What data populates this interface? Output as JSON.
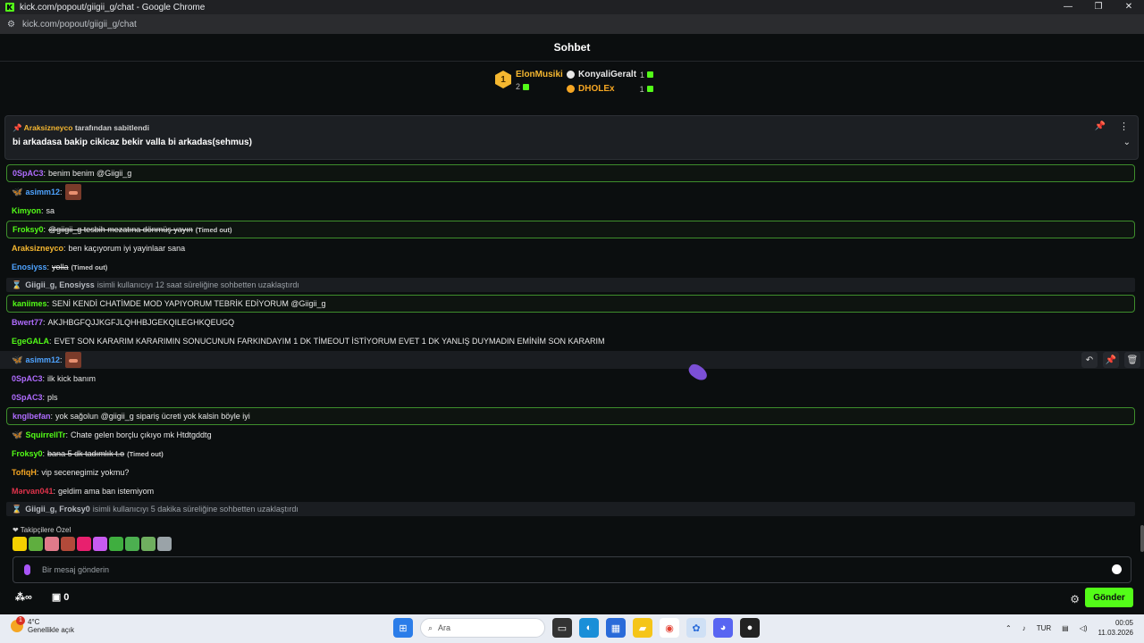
{
  "window": {
    "title": "kick.com/popout/giigii_g/chat - Google Chrome",
    "url": "kick.com/popout/giigii_g/chat",
    "controls": [
      "—",
      "❐",
      "✕"
    ]
  },
  "chat": {
    "title": "Sohbet"
  },
  "leaderboard": {
    "first": {
      "rank": "1",
      "name": "ElonMusiki",
      "count": "2"
    },
    "others": [
      {
        "name": "KonyaliGeralt",
        "count": "1",
        "color": "#e8e8e8"
      },
      {
        "name": "DHOLEx",
        "count": "1",
        "color": "#f5a623"
      }
    ]
  },
  "pinned": {
    "pinned_by_user": "Araksizneyco",
    "pinned_by_suffix": "tarafından sabitlendi",
    "message": "bi arkadasa bakip cikicaz bekir valla bi arkadas(sehmus)"
  },
  "messages": [
    {
      "user": "0SpAC3",
      "color": "#b06cff",
      "text": "benim benim @Giigii_g"
    },
    {
      "user": "asimm12",
      "color": "#4ea3ff",
      "text": ""
    },
    {
      "user": "Kimyon",
      "color": "#53fc18",
      "text": "sa"
    },
    {
      "user": "Froksy0",
      "color": "#53fc18",
      "text": "@giigii_g tesbih mezatına dönmüş yayın",
      "status": "(Timed out)"
    },
    {
      "user": "Araksizneyco",
      "color": "#f5b730",
      "text": "ben kaçıyorum iyi yayinlaar sana"
    },
    {
      "user": "Enosiyss",
      "color": "#4ea3ff",
      "text": "yolla",
      "status": "(Timed out)"
    },
    {
      "names": "Giigii_g, Enosiyss",
      "text": "isimli kullanıcıyı 12 saat süreliğine sohbetten uzaklaştırdı"
    },
    {
      "user": "kaniimes",
      "color": "#53fc18",
      "text": "SENİ KENDİ CHATİMDE MOD YAPIYORUM TEBRİK EDİYORUM @Giigii_g"
    },
    {
      "user": "Bwert77",
      "color": "#b06cff",
      "text": "AKJHBGFQJJKGFJLQHHBJGEKQILEGHKQEUGQ"
    },
    {
      "user": "EgeGALA",
      "color": "#53fc18",
      "text": "EVET SON KARARIM KARARIMIN SONUCUNUN FARKINDAYIM 1 DK TİMEOUT İSTİYORUM EVET 1 DK YANLIŞ DUYMADIN EMİNİM SON KARARIM"
    },
    {
      "user": "asimm12",
      "color": "#4ea3ff",
      "text": ""
    },
    {
      "user": "0SpAC3",
      "color": "#b06cff",
      "text": "ilk kick banım"
    },
    {
      "user": "0SpAC3",
      "color": "#b06cff",
      "text": "pls"
    },
    {
      "user": "knglbefan",
      "color": "#b06cff",
      "text": "yok sağolun @giigii_g sipariş ücreti yok kalsin böyle iyi"
    },
    {
      "user": "SquirrellTr",
      "color": "#53fc18",
      "text": "Chate gelen borçlu çıkıyo mk Htdtgddtg"
    },
    {
      "user": "Froksy0",
      "color": "#53fc18",
      "text": "bana 5 dk tadımlık t.o",
      "status": "(Timed out)"
    },
    {
      "user": "TofiqH",
      "color": "#f5a623",
      "text": "vip secenegimiz yokmu?"
    },
    {
      "user": "Mərvan041",
      "color": "#e0334b",
      "text": "geldim ama ban istemiyom"
    },
    {
      "names": "Giigii_g, Froksy0",
      "text": "isimli kullanıcıyı 5 dakika süreliğine sohbetten uzaklaştırdı"
    }
  ],
  "emote_bar": {
    "label": "Takipçilere Özel",
    "colors": [
      "#f5d000",
      "#5fae3f",
      "#e07a8a",
      "#b24a3a",
      "#e8206e",
      "#c75bf0",
      "#3fae3f",
      "#4caf50",
      "#6fae5f",
      "#9aa3a8"
    ]
  },
  "composer": {
    "placeholder": "Bir mesaj gönderin",
    "points": "0",
    "infinity": "∞",
    "send_label": "Gönder"
  },
  "taskbar": {
    "temp": "4°C",
    "weather": "Genellikle açık",
    "search": "Ara",
    "lang": "TUR",
    "time": "00:05",
    "date": "11.03.2026"
  },
  "colors": {
    "accent": "#53fc18",
    "highlight_border": "#3e8e2c"
  }
}
